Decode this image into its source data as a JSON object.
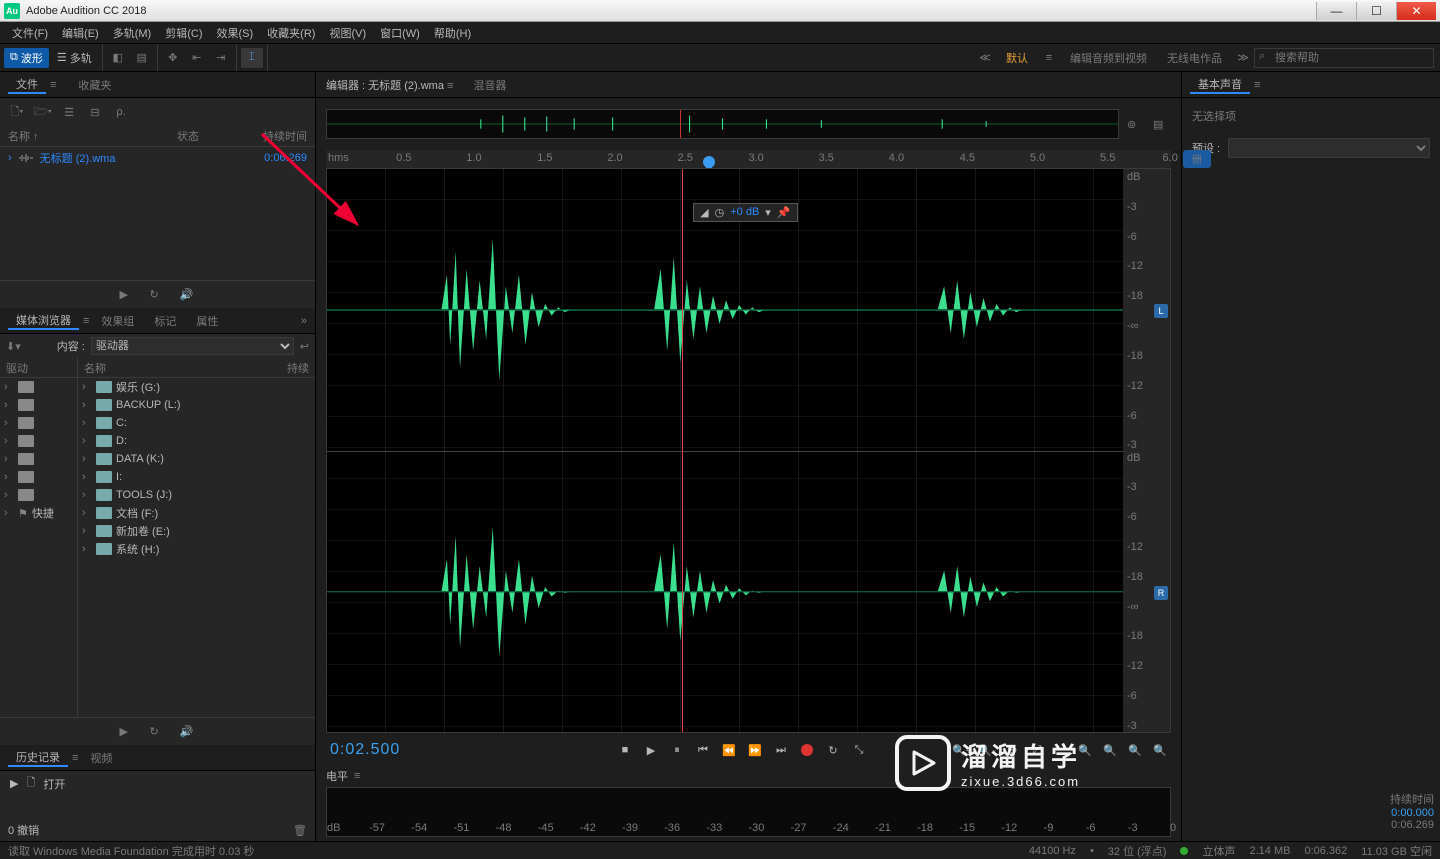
{
  "titlebar": {
    "app": "Adobe Audition CC 2018"
  },
  "menu": [
    "文件(F)",
    "编辑(E)",
    "多轨(M)",
    "剪辑(C)",
    "效果(S)",
    "收藏夹(R)",
    "视图(V)",
    "窗口(W)",
    "帮助(H)"
  ],
  "toolbar": {
    "waveform": "波形",
    "multitrack": "多轨",
    "workspaces": {
      "default": "默认",
      "editAudioToVideo": "编辑音频到视频",
      "radioProduction": "无线电作品"
    },
    "search_placeholder": "搜索帮助"
  },
  "filesPanel": {
    "tabs": {
      "files": "文件",
      "favorites": "收藏夹"
    },
    "cols": {
      "name": "名称 ↑",
      "status": "状态",
      "duration": "持续时间"
    },
    "file": {
      "name": "无标题 (2).wma",
      "duration": "0:06.269"
    }
  },
  "mediaBrowser": {
    "tabs": [
      "媒体浏览器",
      "效果组",
      "标记",
      "属性"
    ],
    "contentLabel": "内容 :",
    "contentValue": "驱动器",
    "leftHdr": "驱动",
    "leftItems": [
      "",
      "",
      "",
      "",
      "",
      "",
      "",
      "快捷"
    ],
    "rightHdr": "名称",
    "rightHdr2": "持续",
    "drives": [
      "娱乐 (G:)",
      "BACKUP (L:)",
      "C:",
      "D:",
      "DATA (K:)",
      "I:",
      "TOOLS (J:)",
      "文档 (F:)",
      "新加卷 (E:)",
      "系统 (H:)"
    ]
  },
  "history": {
    "tabs": [
      "历史记录",
      "视频"
    ],
    "open": "打开",
    "undo": "0 撤销"
  },
  "editor": {
    "tabs": {
      "editor": "编辑器 : 无标题 (2).wma",
      "mixer": "混音器"
    },
    "ruler": [
      "hms",
      "0.5",
      "1.0",
      "1.5",
      "2.0",
      "2.5",
      "3.0",
      "3.5",
      "4.0",
      "4.5",
      "5.0",
      "5.5",
      "6.0"
    ],
    "dbScale": [
      "dB",
      "-3",
      "-6",
      "-12",
      "-18",
      "-∞",
      "-18",
      "-12",
      "-6",
      "-3"
    ],
    "channels": {
      "L": "L",
      "R": "R"
    },
    "hud": {
      "db": "+0 dB"
    },
    "timecode": "0:02.500",
    "freqIcon": "卌"
  },
  "levels": {
    "label": "电平",
    "scale": [
      "dB",
      "-57",
      "-54",
      "-51",
      "-48",
      "-45",
      "-42",
      "-39",
      "-36",
      "-33",
      "-30",
      "-27",
      "-24",
      "-21",
      "-18",
      "-15",
      "-12",
      "-9",
      "-6",
      "-3",
      "0"
    ]
  },
  "essentialSound": {
    "title": "基本声音",
    "noSelection": "无选择项",
    "presetLabel": "预设 :"
  },
  "timeSelection": {
    "label": "持续时间",
    "start": "0:00.000",
    "end": "0:06.269"
  },
  "status": {
    "msg": "读取 Windows Media Foundation 完成用时 0.03 秒",
    "sampleRate": "44100 Hz",
    "bitDepth": "32 位 (浮点)",
    "channels": "立体声",
    "size": "2.14 MB",
    "dur": "0:06.362",
    "disk": "11.03 GB 空闲"
  },
  "watermark": {
    "line1": "溜溜自学",
    "line2": "zixue.3d66.com"
  }
}
